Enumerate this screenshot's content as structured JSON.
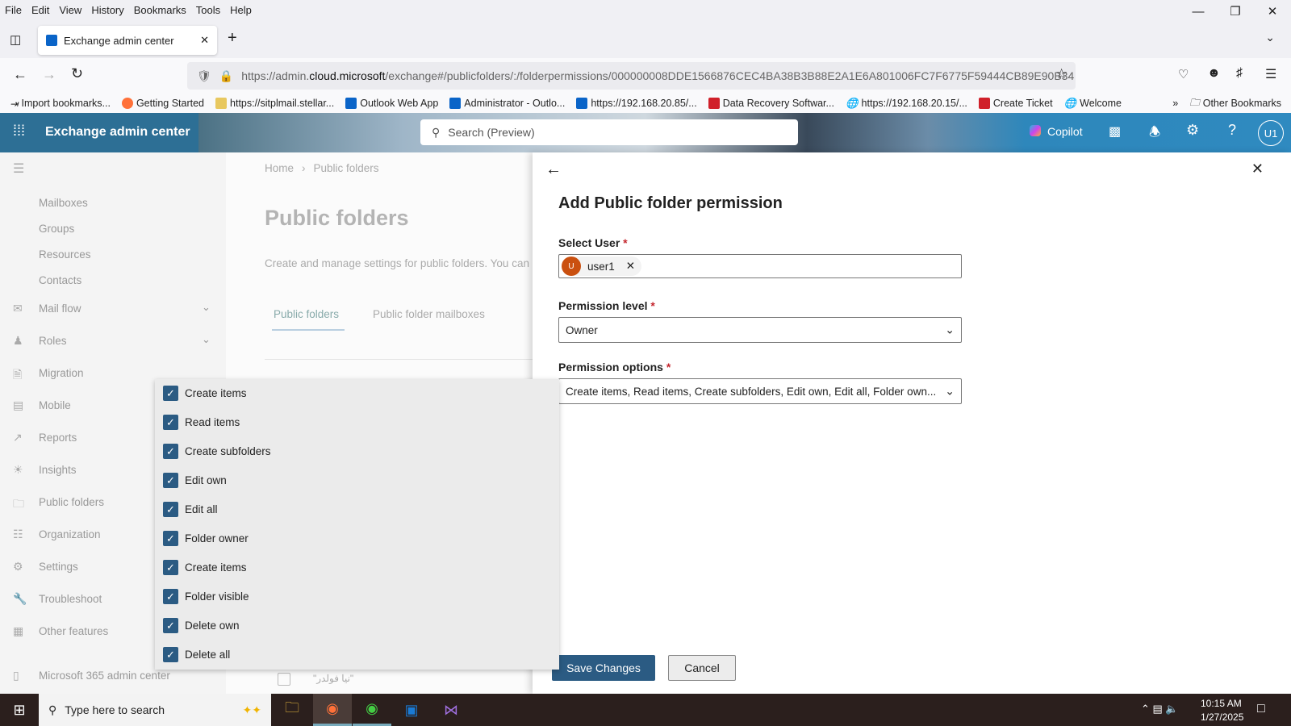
{
  "browser": {
    "menu": [
      "File",
      "Edit",
      "View",
      "History",
      "Bookmarks",
      "Tools",
      "Help"
    ],
    "tab_title": "Exchange admin center",
    "url_prefix": "https://admin.",
    "url_domain": "cloud.microsoft",
    "url_rest": "/exchange#/publicfolders/:/folderpermissions/000000008DDE1566876CEC4BA38B3B88E2A1E6A801006FC7F6775F59444CB89E90B34",
    "bookmarks": [
      "Import bookmarks...",
      "Getting Started",
      "https://sitplmail.stellar...",
      "Outlook Web App",
      "Administrator - Outlo...",
      "https://192.168.20.85/...",
      "Data Recovery Softwar...",
      "https://192.168.20.15/...",
      "Create Ticket",
      "Welcome"
    ],
    "other_bookmarks": "Other Bookmarks"
  },
  "header": {
    "app_title": "Exchange admin center",
    "search_placeholder": "Search (Preview)",
    "copilot": "Copilot",
    "avatar": "U1"
  },
  "nav": {
    "items": [
      "Mailboxes",
      "Groups",
      "Resources",
      "Contacts",
      "Mail flow",
      "Roles",
      "Migration",
      "Mobile",
      "Reports",
      "Insights",
      "Public folders",
      "Organization",
      "Settings",
      "Troubleshoot",
      "Other features",
      "Microsoft 365 admin center"
    ]
  },
  "main": {
    "breadcrumb": [
      "Home",
      "Public folders"
    ],
    "title": "Public folders",
    "description": "Create and manage settings for public folders. You can",
    "tabs": [
      "Public folders",
      "Public folder mailboxes"
    ],
    "row_name": "\"نيا فولدر\""
  },
  "panel": {
    "title": "Add Public folder permission",
    "select_user_label": "Select User",
    "user_initial": "U",
    "user_name": "user1",
    "permission_level_label": "Permission level",
    "permission_level_value": "Owner",
    "permission_options_label": "Permission options",
    "permission_options_value": "Create items, Read items, Create subfolders, Edit own, Edit all, Folder own...",
    "save": "Save Changes",
    "cancel": "Cancel"
  },
  "options": [
    {
      "label": "Create items",
      "checked": true
    },
    {
      "label": "Read items",
      "checked": true
    },
    {
      "label": "Create subfolders",
      "checked": true
    },
    {
      "label": "Edit own",
      "checked": true
    },
    {
      "label": "Edit all",
      "checked": true
    },
    {
      "label": "Folder owner",
      "checked": true
    },
    {
      "label": "Create items",
      "checked": true
    },
    {
      "label": "Folder visible",
      "checked": true
    },
    {
      "label": "Delete own",
      "checked": true
    },
    {
      "label": "Delete all",
      "checked": true
    }
  ],
  "taskbar": {
    "search_placeholder": "Type here to search",
    "time": "10:15 AM",
    "date": "1/27/2025"
  },
  "colors": {
    "accent": "#2b5b83",
    "header": "#2d6f95",
    "user_avatar": "#ca5010"
  }
}
